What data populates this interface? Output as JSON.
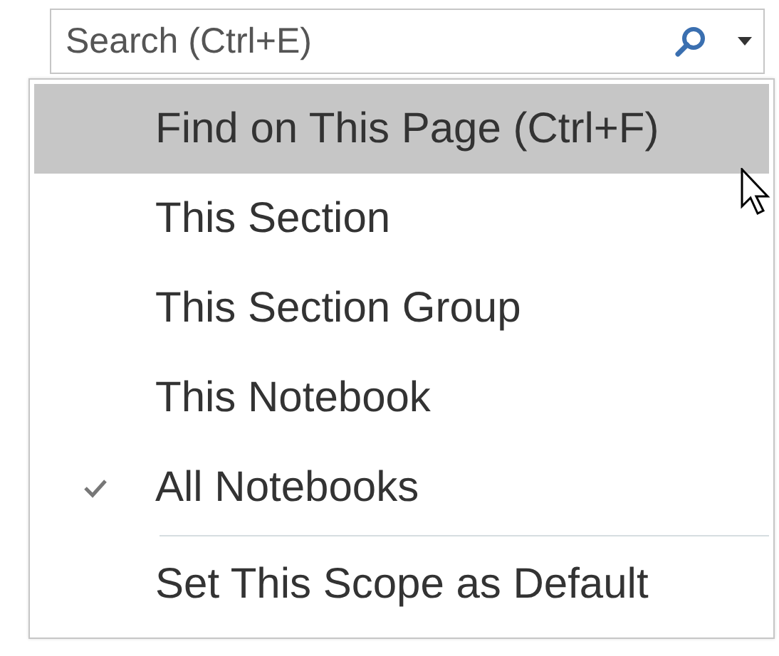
{
  "search": {
    "placeholder": "Search (Ctrl+E)"
  },
  "menu": {
    "items": [
      {
        "label": "Find on This Page (Ctrl+F)",
        "highlighted": true,
        "checked": false,
        "separator_before": false
      },
      {
        "label": "This Section",
        "highlighted": false,
        "checked": false,
        "separator_before": false
      },
      {
        "label": "This Section Group",
        "highlighted": false,
        "checked": false,
        "separator_before": false
      },
      {
        "label": "This Notebook",
        "highlighted": false,
        "checked": false,
        "separator_before": false
      },
      {
        "label": "All Notebooks",
        "highlighted": false,
        "checked": true,
        "separator_before": false
      },
      {
        "label": "Set This Scope as Default",
        "highlighted": false,
        "checked": false,
        "separator_before": true
      }
    ]
  }
}
